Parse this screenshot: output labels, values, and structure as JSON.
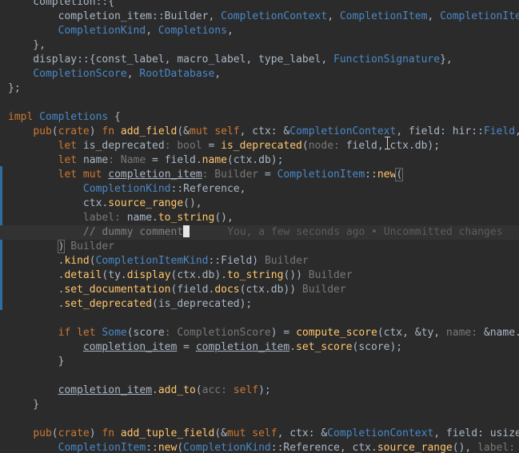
{
  "editor": {
    "lines": [
      [
        {
          "t": "    completion::{",
          "c": "param"
        }
      ],
      [
        {
          "t": "        completion_item",
          "c": "param"
        },
        {
          "t": "::",
          "c": "param"
        },
        {
          "t": "Builder",
          "c": "param"
        },
        {
          "t": ", ",
          "c": "param"
        },
        {
          "t": "CompletionContext",
          "c": "tyd"
        },
        {
          "t": ", ",
          "c": "param"
        },
        {
          "t": "CompletionItem",
          "c": "tyd"
        },
        {
          "t": ", ",
          "c": "param"
        },
        {
          "t": "CompletionIte",
          "c": "tyd"
        }
      ],
      [
        {
          "t": "        ",
          "c": "param"
        },
        {
          "t": "CompletionKind",
          "c": "tyd"
        },
        {
          "t": ", ",
          "c": "param"
        },
        {
          "t": "Completions",
          "c": "tyd"
        },
        {
          "t": ",",
          "c": "param"
        }
      ],
      [
        {
          "t": "    },",
          "c": "param"
        }
      ],
      [
        {
          "t": "    display::{",
          "c": "param"
        },
        {
          "t": "const_label",
          "c": "param"
        },
        {
          "t": ", ",
          "c": "param"
        },
        {
          "t": "macro_label",
          "c": "param"
        },
        {
          "t": ", ",
          "c": "param"
        },
        {
          "t": "type_label",
          "c": "param"
        },
        {
          "t": ", ",
          "c": "param"
        },
        {
          "t": "FunctionSignature",
          "c": "tyd"
        },
        {
          "t": "},",
          "c": "param"
        }
      ],
      [
        {
          "t": "    ",
          "c": "param"
        },
        {
          "t": "CompletionScore",
          "c": "tyd"
        },
        {
          "t": ", ",
          "c": "param"
        },
        {
          "t": "RootDatabase",
          "c": "tyd"
        },
        {
          "t": ",",
          "c": "param"
        }
      ],
      [
        {
          "t": "};",
          "c": "param"
        }
      ],
      [
        {
          "t": "",
          "c": "param"
        }
      ],
      [
        {
          "t": "impl ",
          "c": "kw"
        },
        {
          "t": "Completions",
          "c": "tyd"
        },
        {
          "t": " {",
          "c": "param"
        }
      ],
      [
        {
          "t": "    ",
          "c": "param"
        },
        {
          "t": "pub",
          "c": "kw"
        },
        {
          "t": "(",
          "c": "param"
        },
        {
          "t": "crate",
          "c": "kw"
        },
        {
          "t": ") ",
          "c": "param"
        },
        {
          "t": "fn ",
          "c": "kw"
        },
        {
          "t": "add_field",
          "c": "fn"
        },
        {
          "t": "(&",
          "c": "param"
        },
        {
          "t": "mut self",
          "c": "kw"
        },
        {
          "t": ", ctx: &",
          "c": "param"
        },
        {
          "t": "CompletionContext",
          "c": "tyd"
        },
        {
          "t": ", field: hir::",
          "c": "param"
        },
        {
          "t": "Field",
          "c": "tyd"
        },
        {
          "t": ",",
          "c": "param"
        }
      ],
      [
        {
          "t": "        ",
          "c": "param"
        },
        {
          "t": "let ",
          "c": "kw"
        },
        {
          "t": "is_deprecated",
          "c": "param"
        },
        {
          "t": ": bool",
          "c": "hint"
        },
        {
          "t": " = ",
          "c": "param"
        },
        {
          "t": "is_deprecated",
          "c": "fn"
        },
        {
          "t": "(",
          "c": "param"
        },
        {
          "t": "node: ",
          "c": "hint"
        },
        {
          "t": "field, ctx.db);",
          "c": "param"
        }
      ],
      [
        {
          "t": "        ",
          "c": "param"
        },
        {
          "t": "let ",
          "c": "kw"
        },
        {
          "t": "name",
          "c": "param"
        },
        {
          "t": ": Name",
          "c": "hint"
        },
        {
          "t": " = field.",
          "c": "param"
        },
        {
          "t": "name",
          "c": "fn"
        },
        {
          "t": "(ctx.db);",
          "c": "param"
        }
      ],
      [
        {
          "t": "        ",
          "c": "param"
        },
        {
          "t": "let mut ",
          "c": "kw"
        },
        {
          "t": "completion_item",
          "c": "param ul"
        },
        {
          "t": ": Builder",
          "c": "hint"
        },
        {
          "t": " = ",
          "c": "param"
        },
        {
          "t": "CompletionItem",
          "c": "tyd"
        },
        {
          "t": "::",
          "c": "param"
        },
        {
          "t": "new",
          "c": "fn"
        },
        {
          "t": "(",
          "c": "param bracket-match"
        }
      ],
      [
        {
          "t": "            ",
          "c": "param"
        },
        {
          "t": "CompletionKind",
          "c": "tyd"
        },
        {
          "t": "::",
          "c": "param"
        },
        {
          "t": "Reference",
          "c": "param"
        },
        {
          "t": ",",
          "c": "param"
        }
      ],
      [
        {
          "t": "            ctx.",
          "c": "param"
        },
        {
          "t": "source_range",
          "c": "fn"
        },
        {
          "t": "(),",
          "c": "param"
        }
      ],
      [
        {
          "t": "            ",
          "c": "param"
        },
        {
          "t": "label: ",
          "c": "hint"
        },
        {
          "t": "name.",
          "c": "param"
        },
        {
          "t": "to_string",
          "c": "fn"
        },
        {
          "t": "(),",
          "c": "param"
        }
      ],
      [
        {
          "t": "            // dummy comment",
          "c": "cmt"
        },
        {
          "t": "CARET",
          "c": "caret"
        },
        {
          "t": "      You, a few seconds ago • Uncommitted changes",
          "c": "blame"
        }
      ],
      [
        {
          "t": "        ",
          "c": "param"
        },
        {
          "t": ")",
          "c": "param bracket-match"
        },
        {
          "t": " Builder",
          "c": "hint"
        }
      ],
      [
        {
          "t": "        .",
          "c": "param"
        },
        {
          "t": "kind",
          "c": "fn"
        },
        {
          "t": "(",
          "c": "param"
        },
        {
          "t": "CompletionItemKind",
          "c": "tyd"
        },
        {
          "t": "::",
          "c": "param"
        },
        {
          "t": "Field",
          "c": "param"
        },
        {
          "t": ") ",
          "c": "param"
        },
        {
          "t": "Builder",
          "c": "hint"
        }
      ],
      [
        {
          "t": "        .",
          "c": "param"
        },
        {
          "t": "detail",
          "c": "fn"
        },
        {
          "t": "(ty.",
          "c": "param"
        },
        {
          "t": "display",
          "c": "fn"
        },
        {
          "t": "(ctx.db).",
          "c": "param"
        },
        {
          "t": "to_string",
          "c": "fn"
        },
        {
          "t": "()) ",
          "c": "param"
        },
        {
          "t": "Builder",
          "c": "hint"
        }
      ],
      [
        {
          "t": "        .",
          "c": "param"
        },
        {
          "t": "set_documentation",
          "c": "fn"
        },
        {
          "t": "(field.",
          "c": "param"
        },
        {
          "t": "docs",
          "c": "fn"
        },
        {
          "t": "(ctx.db)) ",
          "c": "param"
        },
        {
          "t": "Builder",
          "c": "hint"
        }
      ],
      [
        {
          "t": "        .",
          "c": "param"
        },
        {
          "t": "set_deprecated",
          "c": "fn"
        },
        {
          "t": "(is_deprecated);",
          "c": "param"
        }
      ],
      [
        {
          "t": "",
          "c": "param"
        }
      ],
      [
        {
          "t": "        ",
          "c": "param"
        },
        {
          "t": "if let ",
          "c": "kw"
        },
        {
          "t": "Some",
          "c": "tyd"
        },
        {
          "t": "(score",
          "c": "param"
        },
        {
          "t": ": CompletionScore",
          "c": "hint"
        },
        {
          "t": ") = ",
          "c": "param"
        },
        {
          "t": "compute_score",
          "c": "fn"
        },
        {
          "t": "(ctx, &ty, ",
          "c": "param"
        },
        {
          "t": "name: ",
          "c": "hint"
        },
        {
          "t": "&name.",
          "c": "param"
        }
      ],
      [
        {
          "t": "            ",
          "c": "param"
        },
        {
          "t": "completion_item",
          "c": "param ul"
        },
        {
          "t": " = ",
          "c": "param"
        },
        {
          "t": "completion_item",
          "c": "param ul"
        },
        {
          "t": ".",
          "c": "param"
        },
        {
          "t": "set_score",
          "c": "fn"
        },
        {
          "t": "(score);",
          "c": "param"
        }
      ],
      [
        {
          "t": "        }",
          "c": "param"
        }
      ],
      [
        {
          "t": "",
          "c": "param"
        }
      ],
      [
        {
          "t": "        ",
          "c": "param"
        },
        {
          "t": "completion_item",
          "c": "param ul"
        },
        {
          "t": ".",
          "c": "param"
        },
        {
          "t": "add_to",
          "c": "fn"
        },
        {
          "t": "(",
          "c": "param"
        },
        {
          "t": "acc: ",
          "c": "hint"
        },
        {
          "t": "self",
          "c": "kw"
        },
        {
          "t": ");",
          "c": "param"
        }
      ],
      [
        {
          "t": "    }",
          "c": "param"
        }
      ],
      [
        {
          "t": "",
          "c": "param"
        }
      ],
      [
        {
          "t": "    ",
          "c": "param"
        },
        {
          "t": "pub",
          "c": "kw"
        },
        {
          "t": "(",
          "c": "param"
        },
        {
          "t": "crate",
          "c": "kw"
        },
        {
          "t": ") ",
          "c": "param"
        },
        {
          "t": "fn ",
          "c": "kw"
        },
        {
          "t": "add_tuple_field",
          "c": "fn"
        },
        {
          "t": "(&",
          "c": "param"
        },
        {
          "t": "mut self",
          "c": "kw"
        },
        {
          "t": ", ctx: &",
          "c": "param"
        },
        {
          "t": "CompletionContext",
          "c": "tyd"
        },
        {
          "t": ", field: usize",
          "c": "param"
        }
      ],
      [
        {
          "t": "        ",
          "c": "param"
        },
        {
          "t": "CompletionItem",
          "c": "tyd"
        },
        {
          "t": "::",
          "c": "param"
        },
        {
          "t": "new",
          "c": "fn"
        },
        {
          "t": "(",
          "c": "param"
        },
        {
          "t": "CompletionKind",
          "c": "tyd"
        },
        {
          "t": "::",
          "c": "param"
        },
        {
          "t": "Reference",
          "c": "param"
        },
        {
          "t": ", ctx.",
          "c": "param"
        },
        {
          "t": "source_range",
          "c": "fn"
        },
        {
          "t": "(), ",
          "c": "param"
        },
        {
          "t": "label: ",
          "c": "hint"
        }
      ]
    ]
  }
}
